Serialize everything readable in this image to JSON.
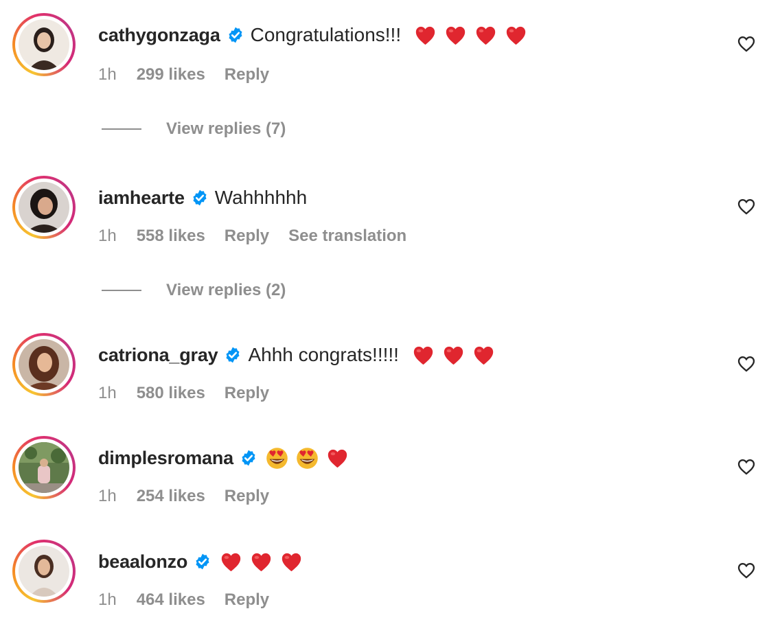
{
  "comments": [
    {
      "username": "cathygonzaga",
      "text": "Congratulations!!!",
      "emojis": [
        "red-heart",
        "red-heart",
        "red-heart",
        "red-heart"
      ],
      "time": "1h",
      "likes": "299 likes",
      "reply_label": "Reply",
      "view_replies": "View replies (7)"
    },
    {
      "username": "iamhearte",
      "text": "Wahhhhhh",
      "emojis": [],
      "time": "1h",
      "likes": "558 likes",
      "reply_label": "Reply",
      "translate_label": "See translation",
      "view_replies": "View replies (2)"
    },
    {
      "username": "catriona_gray",
      "text": "Ahhh congrats!!!!!",
      "emojis": [
        "red-heart",
        "red-heart",
        "red-heart"
      ],
      "time": "1h",
      "likes": "580 likes",
      "reply_label": "Reply"
    },
    {
      "username": "dimplesromana",
      "text": "",
      "emojis": [
        "heart-eyes",
        "heart-eyes",
        "red-heart"
      ],
      "time": "1h",
      "likes": "254 likes",
      "reply_label": "Reply"
    },
    {
      "username": "beaalonzo",
      "text": "",
      "emojis": [
        "red-heart",
        "red-heart",
        "red-heart"
      ],
      "time": "1h",
      "likes": "464 likes",
      "reply_label": "Reply"
    }
  ],
  "icons": {
    "verified": "verified-badge-icon",
    "like": "heart-outline-icon"
  },
  "colors": {
    "verified_blue": "#0095f6",
    "muted_text": "#8e8e8e",
    "primary_text": "#262626",
    "heart_red": "#e0262f"
  }
}
